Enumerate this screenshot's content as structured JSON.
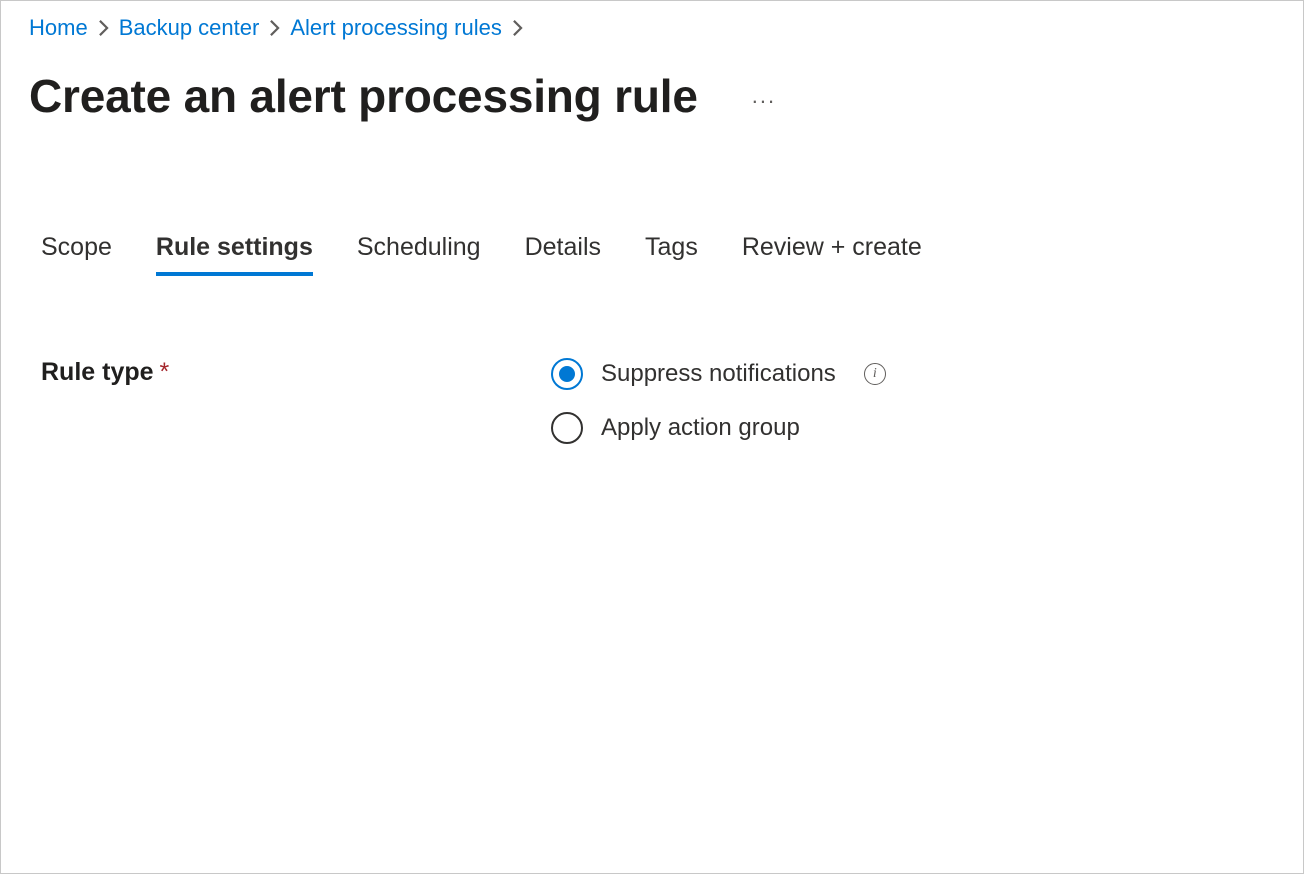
{
  "breadcrumb": {
    "items": [
      {
        "label": "Home"
      },
      {
        "label": "Backup center"
      },
      {
        "label": "Alert processing rules"
      }
    ]
  },
  "page": {
    "title": "Create an alert processing rule",
    "more": "..."
  },
  "tabs": [
    {
      "label": "Scope",
      "active": false
    },
    {
      "label": "Rule settings",
      "active": true
    },
    {
      "label": "Scheduling",
      "active": false
    },
    {
      "label": "Details",
      "active": false
    },
    {
      "label": "Tags",
      "active": false
    },
    {
      "label": "Review + create",
      "active": false
    }
  ],
  "form": {
    "rule_type": {
      "label": "Rule type",
      "required_mark": "*",
      "options": [
        {
          "label": "Suppress notifications",
          "selected": true,
          "has_info": true
        },
        {
          "label": "Apply action group",
          "selected": false,
          "has_info": false
        }
      ]
    }
  }
}
